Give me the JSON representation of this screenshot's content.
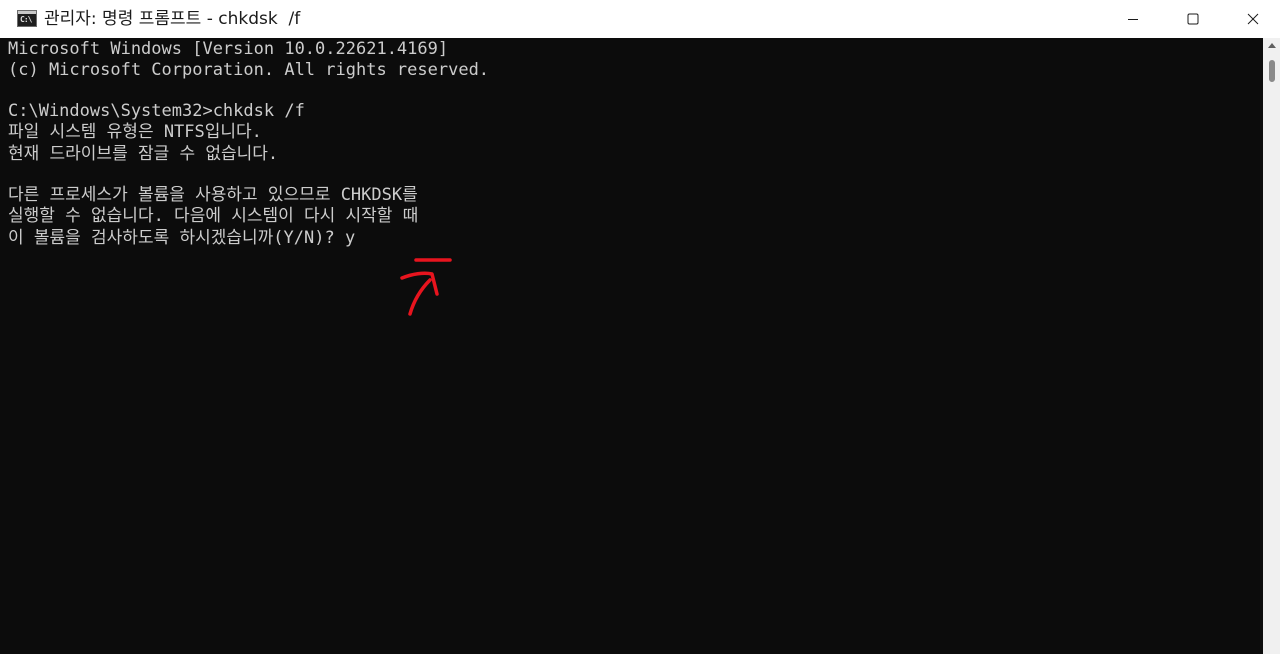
{
  "window": {
    "title": "관리자: 명령 프롬프트 - chkdsk  /f",
    "icon_label": "C:\\"
  },
  "console": {
    "lines": [
      "Microsoft Windows [Version 10.0.22621.4169]",
      "(c) Microsoft Corporation. All rights reserved.",
      "",
      "C:\\Windows\\System32>chkdsk /f",
      "파일 시스템 유형은 NTFS입니다.",
      "현재 드라이브를 잠글 수 없습니다.",
      "",
      "다른 프로세스가 볼륨을 사용하고 있으므로 CHKDSK를",
      "실행할 수 없습니다. 다음에 시스템이 다시 시작할 때",
      "이 볼륨을 검사하도록 하시겠습니까(Y/N)? y"
    ]
  },
  "icons": {
    "app": "command-prompt-icon",
    "minimize": "minimize-icon",
    "maximize": "maximize-icon",
    "close": "close-icon",
    "annotation": "red-arrow-annotation"
  },
  "colors": {
    "console_bg": "#0c0c0c",
    "console_text": "#cccccc",
    "titlebar_bg": "#ffffff",
    "annotation": "#e8141e"
  }
}
